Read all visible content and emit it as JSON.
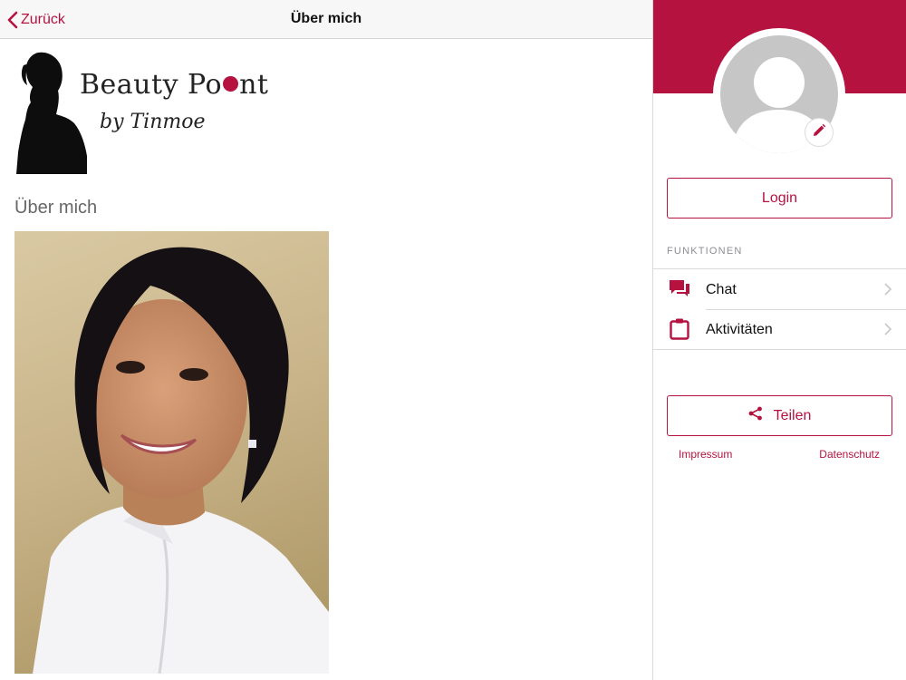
{
  "colors": {
    "accent": "#b5123f",
    "navbar_bg": "#f7f7f7",
    "avatar_gray": "#c6c6c6"
  },
  "navbar": {
    "back_label": "Zurück",
    "back_icon": "chevron-left-icon",
    "title": "Über mich"
  },
  "logo": {
    "brand_pre": "Beauty Po",
    "brand_post": "nt",
    "subtitle": "by Tinmoe"
  },
  "content": {
    "heading": "Über mich"
  },
  "sidebar": {
    "edit_icon": "pencil-icon",
    "login_label": "Login",
    "section_label": "FUNKTIONEN",
    "items": [
      {
        "label": "Chat",
        "icon": "chat-bubbles-icon"
      },
      {
        "label": "Aktivitäten",
        "icon": "clipboard-icon"
      }
    ],
    "share_label": "Teilen",
    "share_icon": "share-icon",
    "footer": {
      "impressum": "Impressum",
      "datenschutz": "Datenschutz"
    }
  }
}
